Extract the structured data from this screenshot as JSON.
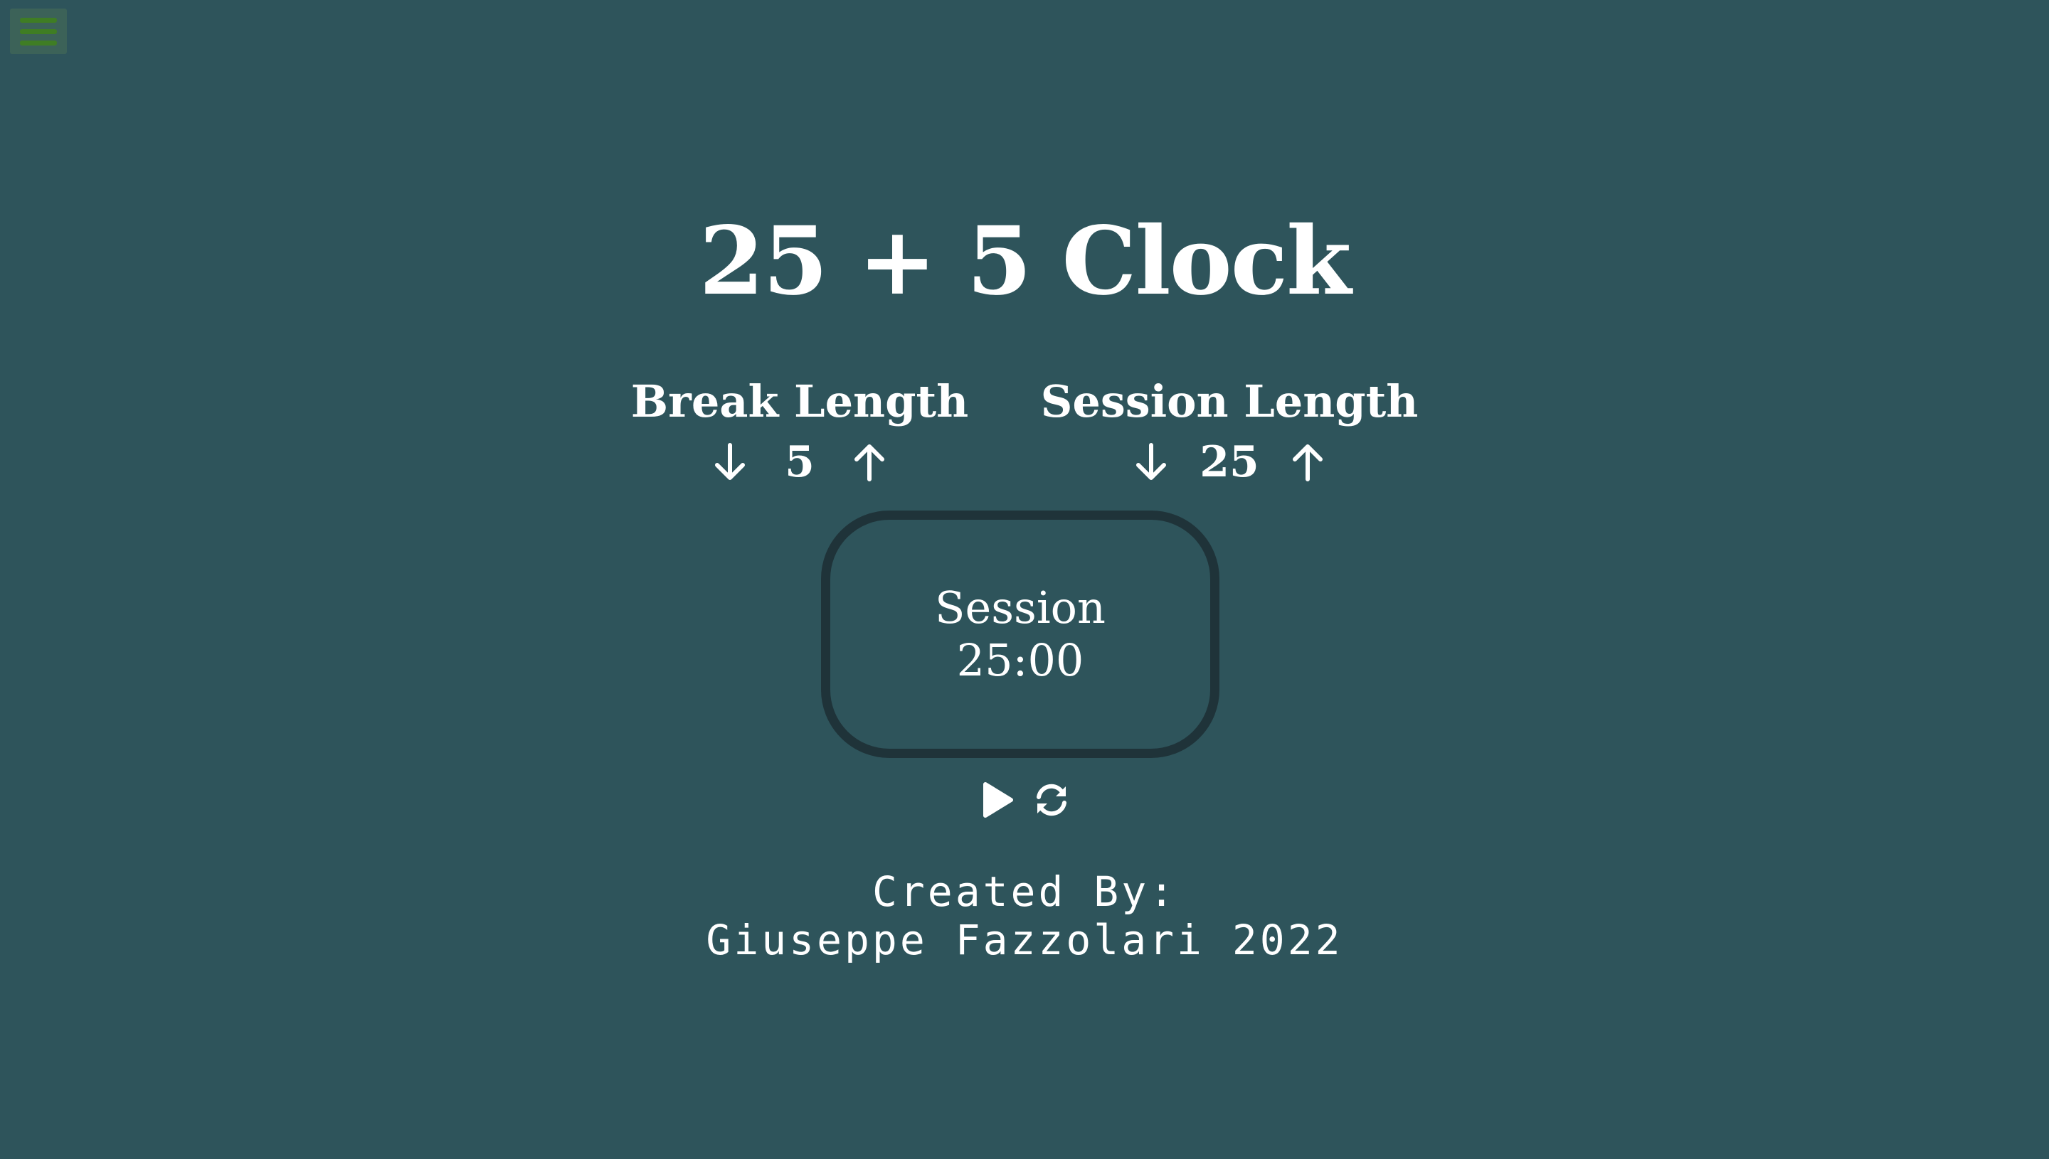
{
  "app": {
    "title": "25 + 5 Clock"
  },
  "menu": {
    "icon": "hamburger-menu-icon",
    "color": "#3f7d24"
  },
  "break_control": {
    "label": "Break Length",
    "value": "5",
    "decrement_icon": "arrow-down-icon",
    "increment_icon": "arrow-up-icon"
  },
  "session_control": {
    "label": "Session Length",
    "value": "25",
    "decrement_icon": "arrow-down-icon",
    "increment_icon": "arrow-up-icon"
  },
  "timer": {
    "label": "Session",
    "time": "25:00"
  },
  "controls": {
    "play_icon": "play-icon",
    "reset_icon": "refresh-icon"
  },
  "footer": {
    "line1": "Created By:",
    "line2": "Giuseppe Fazzolari 2022"
  },
  "colors": {
    "background": "#2e545b",
    "timer_border": "#1f3339",
    "text": "#ffffff"
  }
}
